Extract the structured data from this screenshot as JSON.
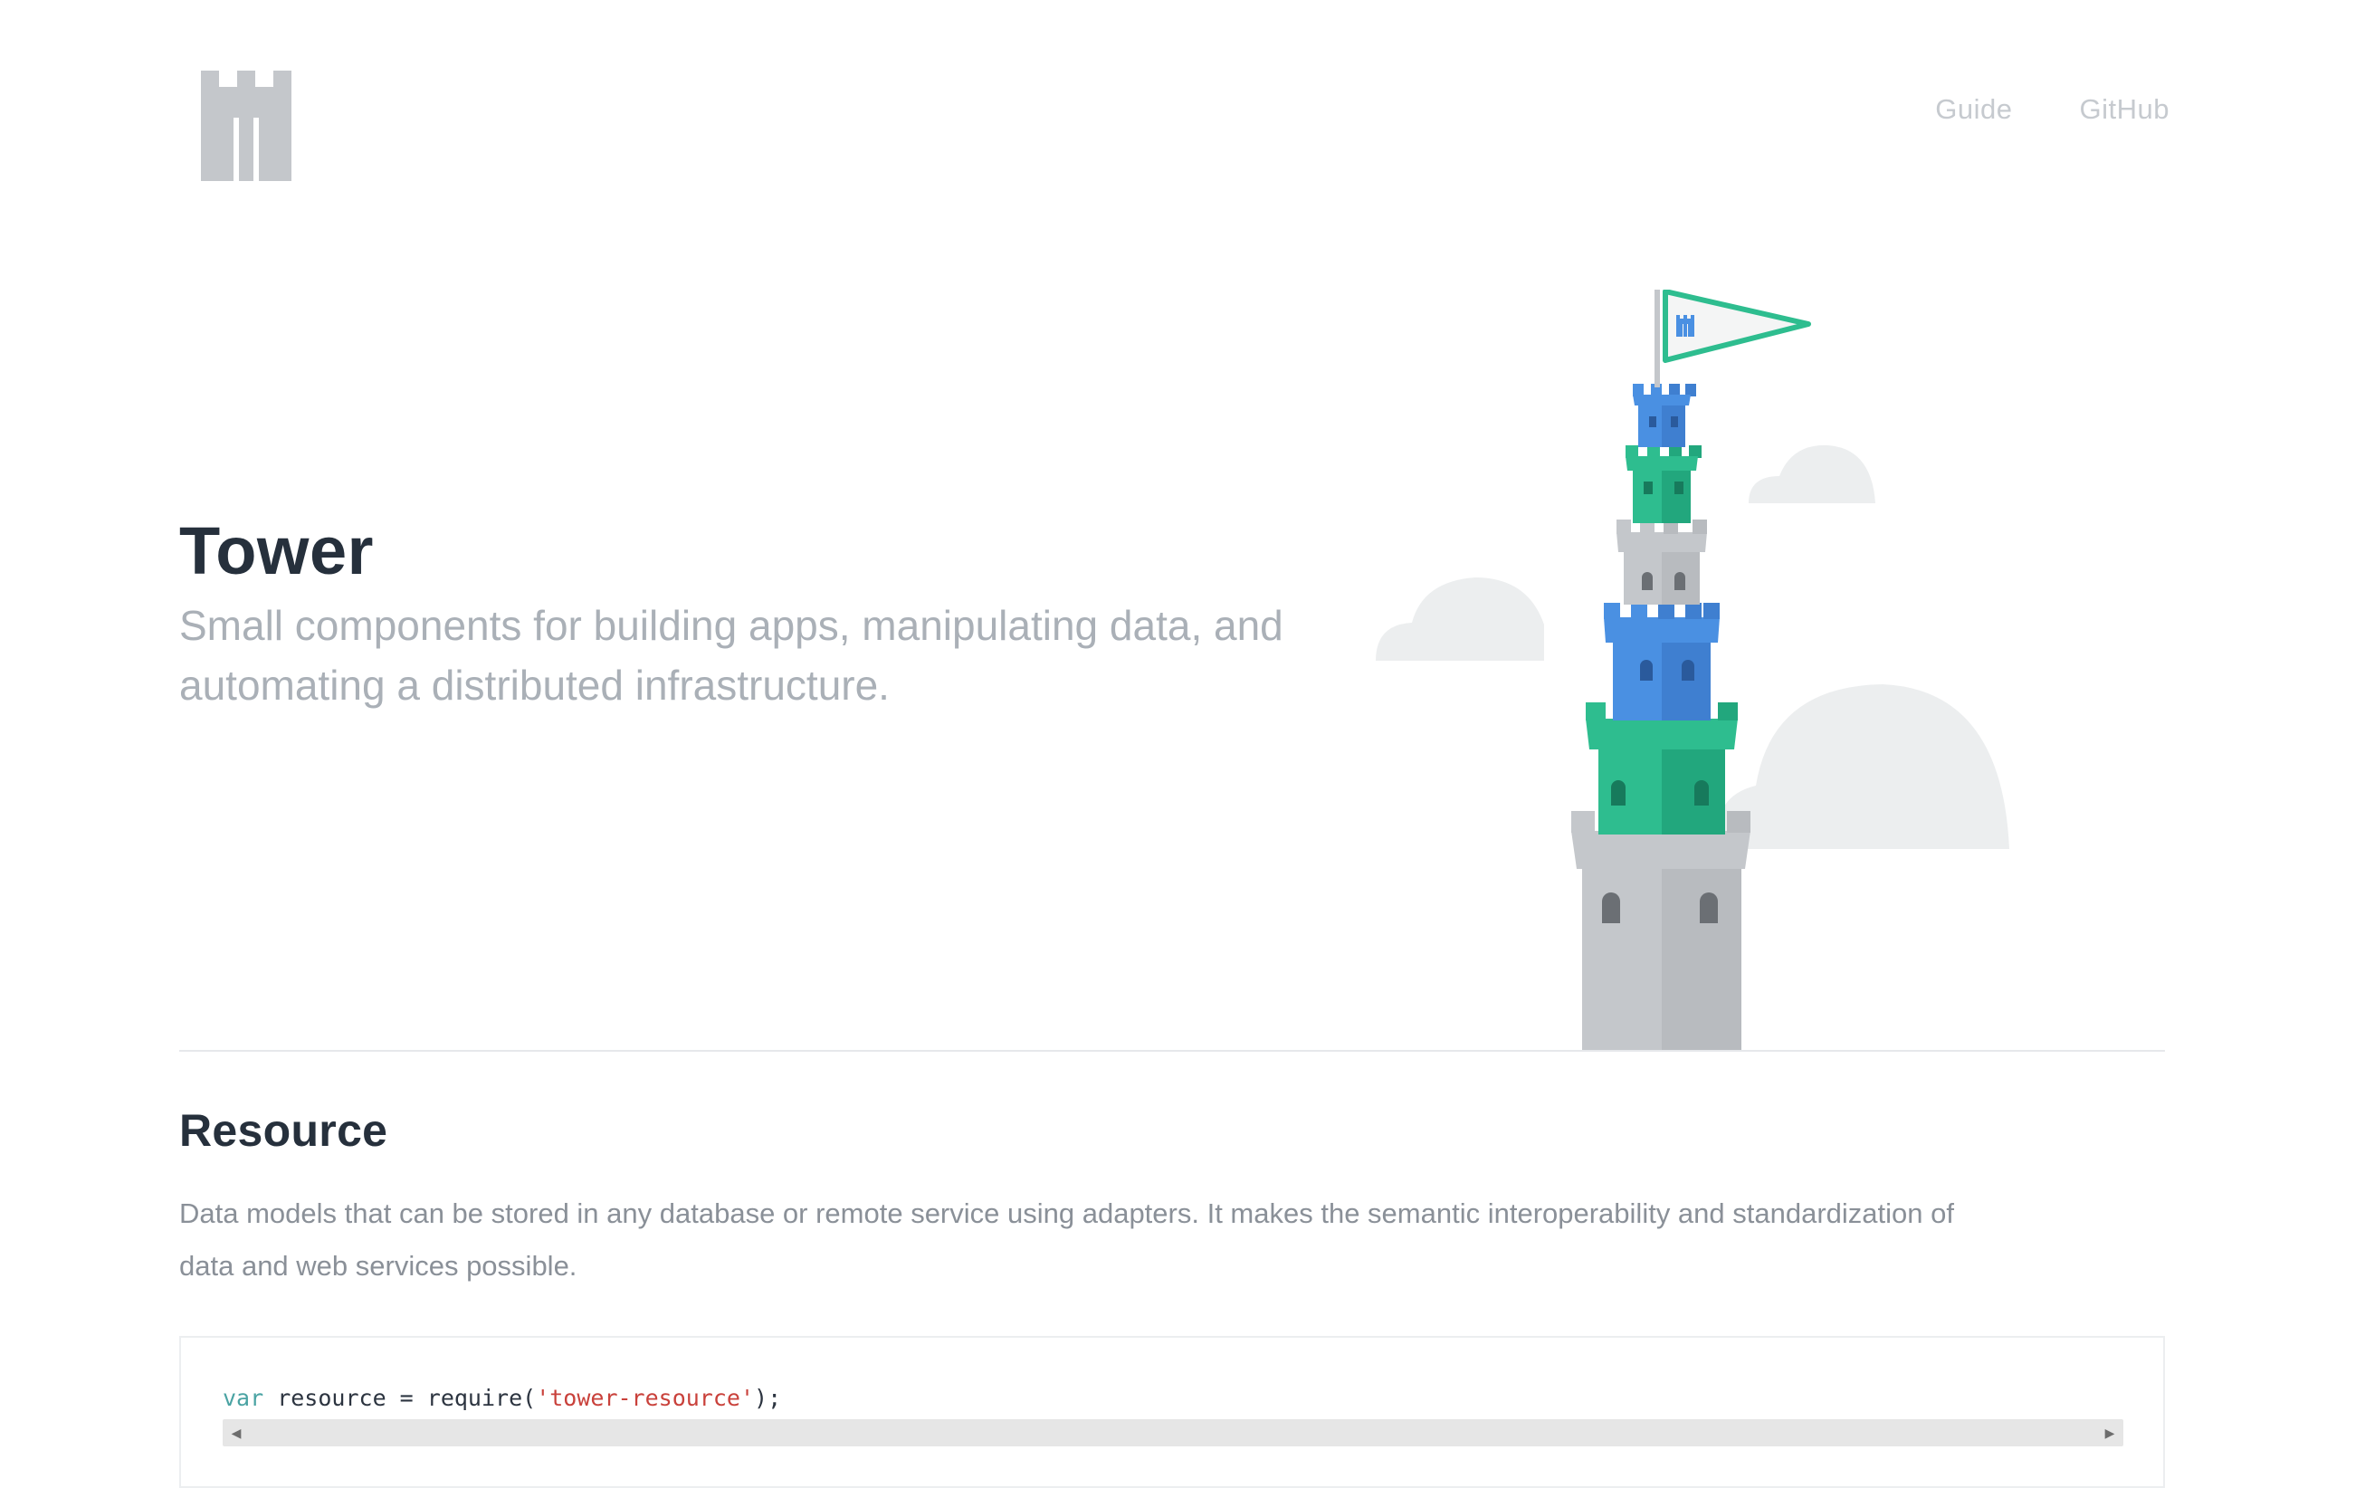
{
  "brand": {
    "logo": "tower-logo-icon"
  },
  "nav": {
    "items": [
      {
        "label": "Guide"
      },
      {
        "label": "GitHub"
      }
    ]
  },
  "hero": {
    "title": "Tower",
    "subtitle_line1": "Small components for building apps, manipulating data, and",
    "subtitle_line2": "automating a distributed infrastructure."
  },
  "illustration": {
    "name": "tower-illustration",
    "colors": {
      "blue": "#4a90e2",
      "green": "#2ebd8f",
      "gray": "#c4c7cb",
      "cloud": "#eceeef"
    }
  },
  "resource": {
    "heading": "Resource",
    "description_line1": "Data models that can be stored in any database or remote service using adapters. It makes the semantic interoperability and standardization of",
    "description_line2": "data and web services possible.",
    "code": {
      "keyword": "var",
      "before": " resource = require(",
      "string": "'tower-resource'",
      "after": ");"
    }
  },
  "scrollbar": {
    "left_icon": "scroll-left-arrow-icon",
    "right_icon": "scroll-right-arrow-icon"
  }
}
